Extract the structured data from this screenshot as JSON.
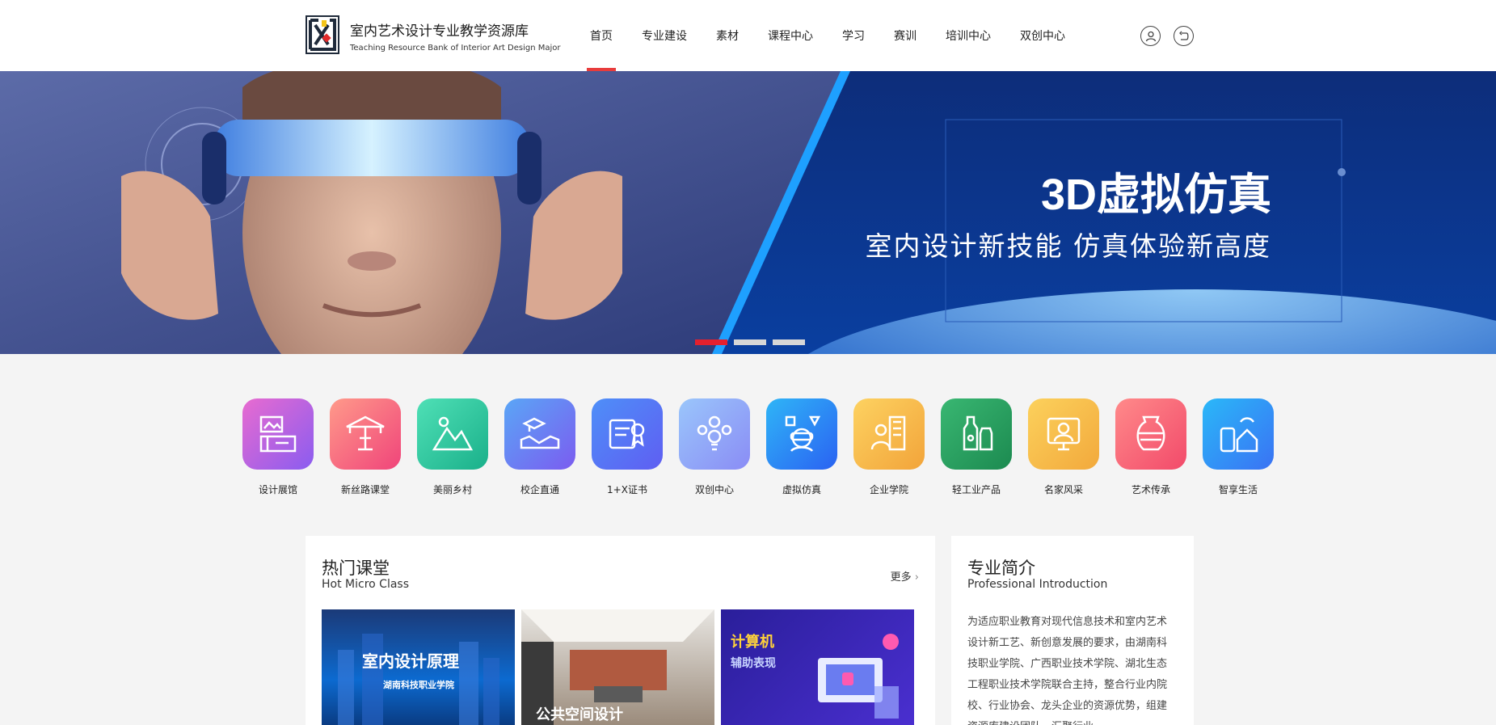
{
  "brand": {
    "name_cn": "室内艺术设计专业教学资源库",
    "name_en": "Teaching Resource Bank of Interior Art Design Major"
  },
  "nav": {
    "items": [
      "首页",
      "专业建设",
      "素材",
      "课程中心",
      "学习",
      "赛训",
      "培训中心",
      "双创中心"
    ],
    "active_index": 0
  },
  "header_icons": [
    "user-icon",
    "logout-icon"
  ],
  "banner": {
    "title": "3D虚拟仿真",
    "subtitle": "室内设计新技能  仿真体验新高度",
    "slide_count": 3,
    "active_slide": 0
  },
  "categories": [
    {
      "label": "设计展馆",
      "icon": "design-gallery-icon",
      "color1": "#e86bd0",
      "color2": "#8a5cf0"
    },
    {
      "label": "新丝路课堂",
      "icon": "pavilion-icon",
      "color1": "#ff9a8a",
      "color2": "#f0447a"
    },
    {
      "label": "美丽乡村",
      "icon": "mountain-village-icon",
      "color1": "#4fe0b6",
      "color2": "#1ab08a"
    },
    {
      "label": "校企直通",
      "icon": "handshake-icon",
      "color1": "#5aa6f6",
      "color2": "#7b5cf0"
    },
    {
      "label": "1+X证书",
      "icon": "certificate-icon",
      "color1": "#4e8ff8",
      "color2": "#5f5ef2"
    },
    {
      "label": "双创中心",
      "icon": "lightbulb-icon",
      "color1": "#9ac6fb",
      "color2": "#8a8cf5"
    },
    {
      "label": "虚拟仿真",
      "icon": "vr-headset-icon",
      "color1": "#2fb5f7",
      "color2": "#2a62f2"
    },
    {
      "label": "企业学院",
      "icon": "enterprise-icon",
      "color1": "#fdd261",
      "color2": "#f2a43a"
    },
    {
      "label": "轻工业产品",
      "icon": "bottles-icon",
      "color1": "#39b772",
      "color2": "#1c8a50"
    },
    {
      "label": "名家风采",
      "icon": "master-icon",
      "color1": "#fcd15c",
      "color2": "#f2a93c"
    },
    {
      "label": "艺术传承",
      "icon": "vase-icon",
      "color1": "#ff8a8a",
      "color2": "#f24a6a"
    },
    {
      "label": "智享生活",
      "icon": "smart-home-icon",
      "color1": "#2ab8f8",
      "color2": "#3a72f4"
    }
  ],
  "hot_class": {
    "title": "热门课堂",
    "subtitle": "Hot Micro Class",
    "more": "更多",
    "thumbs": [
      {
        "line1": "室内设计原理",
        "line2": "湖南科技职业学院"
      },
      {
        "line1": "公共空间设计"
      },
      {
        "line1": "计算机",
        "line2": "辅助表现"
      }
    ]
  },
  "intro": {
    "title": "专业简介",
    "subtitle": "Professional Introduction",
    "text": "为适应职业教育对现代信息技术和室内艺术设计新工艺、新创意发展的要求，由湖南科技职业学院、广西职业技术学院、湖北生态工程职业技术学院联合主持，整合行业内院校、行业协会、龙头企业的资源优势，组建资源库建设团队，汇聚行业一"
  }
}
